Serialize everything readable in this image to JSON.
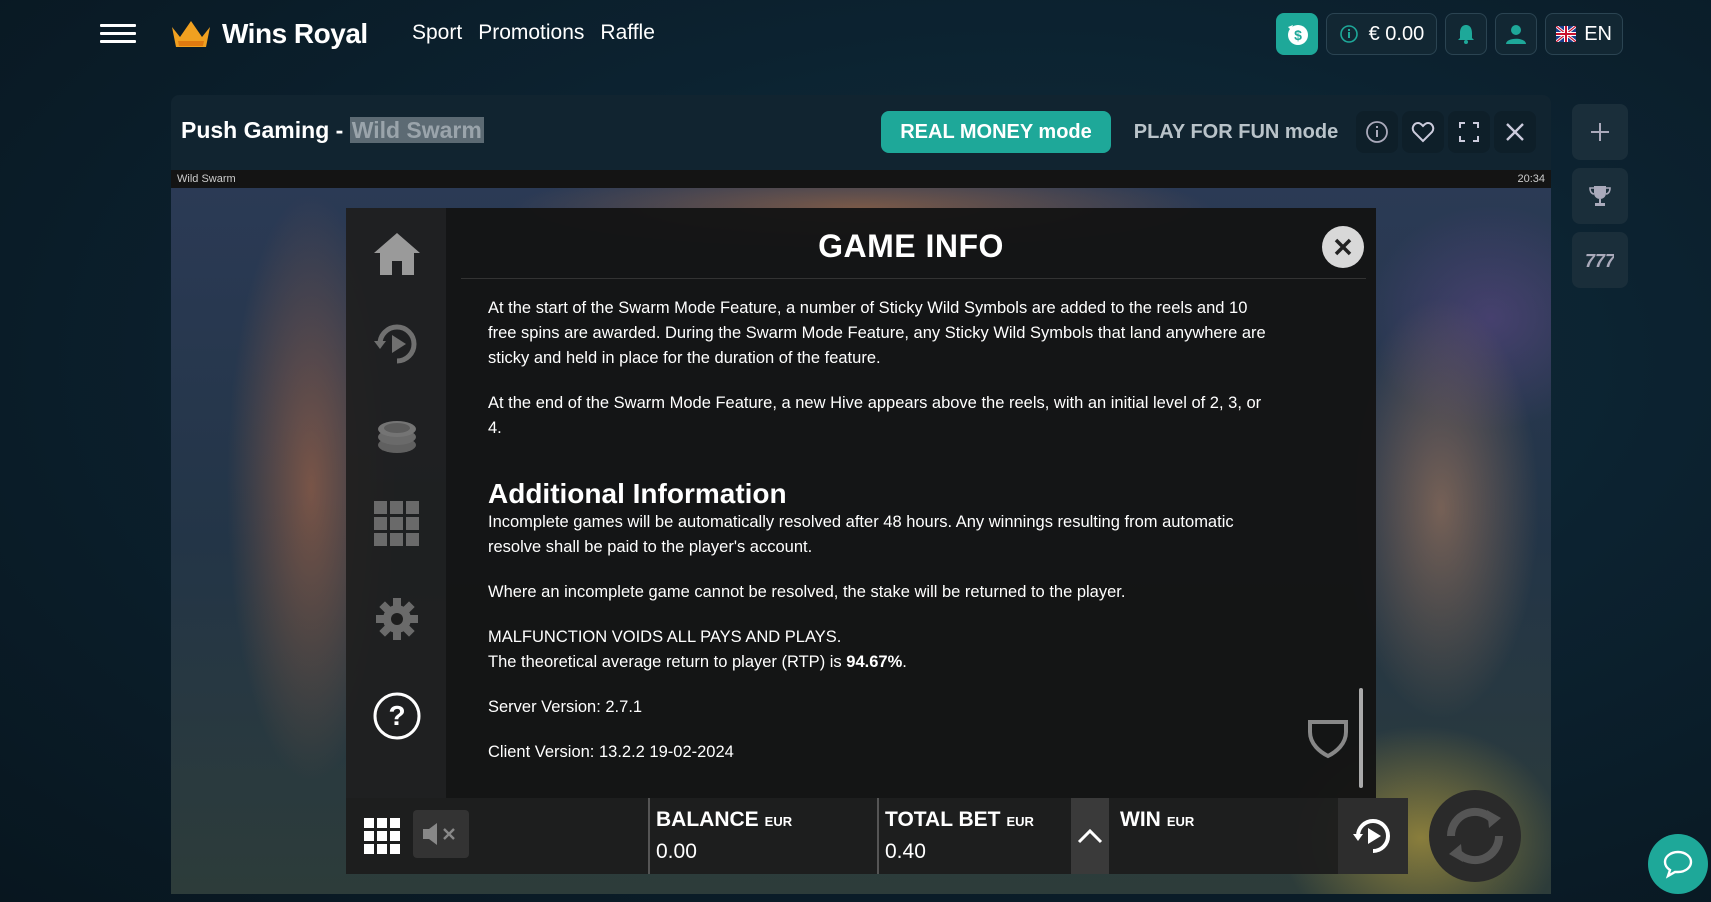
{
  "nav": {
    "brand": "Wins Royal",
    "links": [
      "Sport",
      "Promotions",
      "Raffle"
    ],
    "balance": "€ 0.00",
    "language": "EN"
  },
  "game_header": {
    "provider": "Push Gaming -",
    "game_name": "Wild Swarm",
    "real_mode": "REAL MONEY mode",
    "fun_mode": "PLAY FOR FUN mode"
  },
  "frame": {
    "label": "Wild Swarm",
    "clock": "20:34"
  },
  "info": {
    "title": "GAME INFO",
    "p1": "At the start of the Swarm Mode Feature, a number of Sticky Wild Symbols are added to the reels and 10 free spins are awarded. During the Swarm Mode Feature, any Sticky Wild Symbols that land anywhere are sticky and held in place for the duration of the feature.",
    "p2": "At the end of the Swarm Mode Feature, a new Hive appears above the reels, with an initial level of 2, 3, or 4.",
    "heading": "Additional Information",
    "p3": "Incomplete games will be automatically resolved after 48 hours. Any winnings resulting from automatic resolve shall be paid to the player's account.",
    "p4": "Where an incomplete game cannot be resolved, the stake will be returned to the player.",
    "p5": "MALFUNCTION VOIDS ALL PAYS AND PLAYS.",
    "rtp_text": "The theoretical average return to player (RTP) is",
    "rtp_value": "94.67%",
    "rtp_end": ".",
    "server_version": "Server Version: 2.7.1",
    "client_version": "Client Version: 13.2.2 19-02-2024"
  },
  "bottom": {
    "balance_label": "BALANCE",
    "balance_currency": "EUR",
    "balance_value": "0.00",
    "bet_label": "TOTAL BET",
    "bet_currency": "EUR",
    "bet_value": "0.40",
    "win_label": "WIN",
    "win_currency": "EUR"
  },
  "colors": {
    "accent": "#1ea899",
    "background": "#0c2230"
  }
}
